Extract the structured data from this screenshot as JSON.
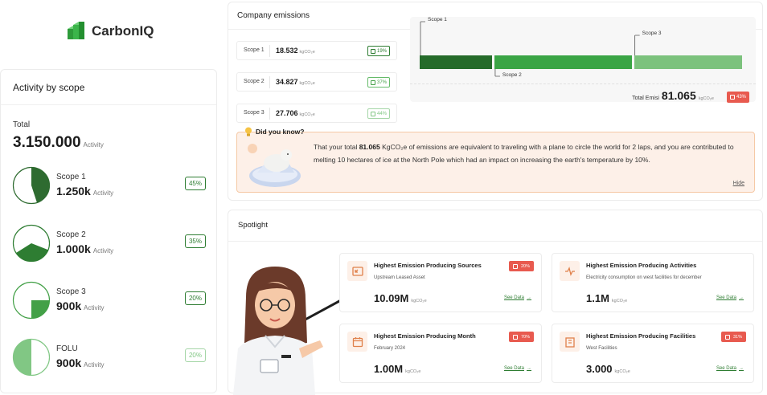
{
  "brand": {
    "name": "CarbonIQ"
  },
  "activity": {
    "title": "Activity by scope",
    "total_label": "Total",
    "total_value": "3.150.000",
    "total_unit": "Activity",
    "scopes": [
      {
        "name": "Scope 1",
        "value": "1.250k",
        "unit": "Activity",
        "percent": "45%",
        "fraction": 0.45,
        "color": "#2e6b30"
      },
      {
        "name": "Scope 2",
        "value": "1.000k",
        "unit": "Activity",
        "percent": "35%",
        "fraction": 0.35,
        "color": "#2e7d32"
      },
      {
        "name": "Scope 3",
        "value": "900k",
        "unit": "Activity",
        "percent": "20%",
        "fraction": 0.25,
        "color": "#43a047"
      },
      {
        "name": "FOLU",
        "value": "900k",
        "unit": "Activity",
        "percent": "20%",
        "fraction": 0.5,
        "color": "#81c784"
      }
    ]
  },
  "company": {
    "title": "Company emissions",
    "rows": [
      {
        "name": "Scope 1",
        "value": "18.532",
        "unit": "kgCO₂e",
        "percent": "19%"
      },
      {
        "name": "Scope 2",
        "value": "34.827",
        "unit": "kgCO₂e",
        "percent": "37%"
      },
      {
        "name": "Scope 3",
        "value": "27.706",
        "unit": "kgCO₂e",
        "percent": "44%"
      }
    ],
    "bar": [
      {
        "label": "Scope 1",
        "color": "#256b2a",
        "fraction": 0.23
      },
      {
        "label": "Scope 2",
        "color": "#3aa545",
        "fraction": 0.43
      },
      {
        "label": "Scope 3",
        "color": "#7cc27d",
        "fraction": 0.34
      }
    ],
    "total_label": "Total Emisi",
    "total_value": "81.065",
    "total_unit": "kgCO₂e",
    "total_percent": "43%"
  },
  "did_you_know": {
    "title": "Did you know?",
    "text_1": "That your total ",
    "highlight": "81.065",
    "text_2": " KgCO₂e of emissions are equivalent to traveling with a plane to circle the world for 2 laps, and you are  contributed to melting 10 hectares of  ice at the North Pole which had an impact on increasing the earth's temperature by 10%.",
    "hide": "Hide"
  },
  "spotlight": {
    "title": "Spotlight",
    "cards": [
      {
        "name": "Highest Emission Producing Sources",
        "sub": "Upstream Leased Asset",
        "value": "10.09M",
        "unit": "kgCO₂e",
        "percent": "20%",
        "link": "See Data",
        "icon": "import-icon"
      },
      {
        "name": "Highest Emission Producing Activities",
        "sub": "Electricity consumption on west facilities for december",
        "value": "1.1M",
        "unit": "kgCO₂e",
        "percent": "",
        "link": "See Data",
        "icon": "pulse-icon"
      },
      {
        "name": "Highest Emission Producing Month",
        "sub": "February 2024",
        "value": "1.00M",
        "unit": "kgCO₂e",
        "percent": "70%",
        "link": "See Data",
        "icon": "calendar-icon"
      },
      {
        "name": "Highest Emission Producing Facilities",
        "sub": "West Facilities",
        "value": "3.000",
        "unit": "kgCO₂e",
        "percent": "31%",
        "link": "See Data",
        "icon": "building-icon"
      }
    ]
  }
}
